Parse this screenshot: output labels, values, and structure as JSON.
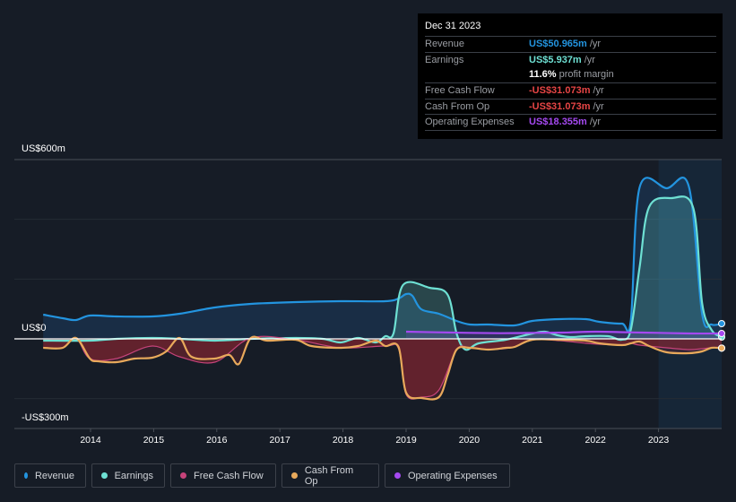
{
  "tooltip": {
    "date": "Dec 31 2023",
    "rows": [
      {
        "label": "Revenue",
        "value": "US$50.965m",
        "unit": "/yr",
        "color": "#2394df"
      },
      {
        "label": "Earnings",
        "value": "US$5.937m",
        "unit": "/yr",
        "color": "#6ee0d3"
      },
      {
        "label": "",
        "value": "11.6%",
        "unit": "profit margin",
        "color": "#ffffff"
      },
      {
        "label": "Free Cash Flow",
        "value": "-US$31.073m",
        "unit": "/yr",
        "color": "#e64545"
      },
      {
        "label": "Cash From Op",
        "value": "-US$31.073m",
        "unit": "/yr",
        "color": "#e64545"
      },
      {
        "label": "Operating Expenses",
        "value": "US$18.355m",
        "unit": "/yr",
        "color": "#a549f0"
      }
    ]
  },
  "legend": [
    {
      "label": "Revenue",
      "color": "#2394df"
    },
    {
      "label": "Earnings",
      "color": "#6ee0d3"
    },
    {
      "label": "Free Cash Flow",
      "color": "#c6437a"
    },
    {
      "label": "Cash From Op",
      "color": "#e8a95b"
    },
    {
      "label": "Operating Expenses",
      "color": "#a549f0"
    }
  ],
  "chart_data": {
    "type": "line",
    "title": "",
    "xlabel": "",
    "ylabel": "",
    "y_tick_labels": [
      "US$600m",
      "US$0",
      "-US$300m"
    ],
    "ylim": [
      -300,
      600
    ],
    "xlim": [
      2013.25,
      2024.0
    ],
    "x_ticks": [
      "2014",
      "2015",
      "2016",
      "2017",
      "2018",
      "2019",
      "2020",
      "2021",
      "2022",
      "2023"
    ],
    "forecast_shade_start": 2023.0,
    "grid": true,
    "legend_position": "bottom-left",
    "series": [
      {
        "name": "Revenue",
        "color": "#2394df",
        "x": [
          2013.25,
          2013.56,
          2013.77,
          2013.99,
          2014.41,
          2014.98,
          2015.41,
          2015.97,
          2016.54,
          2017.25,
          2017.96,
          2018.67,
          2018.88,
          2019.0,
          2019.1,
          2019.24,
          2019.52,
          2019.8,
          2020.01,
          2020.3,
          2020.72,
          2021.0,
          2021.43,
          2021.85,
          2022.06,
          2022.42,
          2022.56,
          2022.7,
          2023.13,
          2023.48,
          2023.69,
          2023.84,
          2024.0
        ],
        "y": [
          81,
          69,
          63,
          78,
          75,
          75,
          84,
          105,
          117,
          123,
          126,
          126,
          135,
          150,
          144,
          99,
          84,
          60,
          48,
          48,
          45,
          60,
          66,
          66,
          57,
          51,
          60,
          507,
          504,
          510,
          84,
          48,
          51
        ]
      },
      {
        "name": "Earnings",
        "color": "#6ee0d3",
        "x": [
          2013.25,
          2013.99,
          2014.41,
          2014.98,
          2015.41,
          2015.97,
          2016.54,
          2017.25,
          2017.68,
          2017.96,
          2018.24,
          2018.52,
          2018.67,
          2018.8,
          2018.95,
          2019.37,
          2019.66,
          2019.8,
          2019.94,
          2020.15,
          2020.58,
          2021.0,
          2021.2,
          2021.4,
          2021.6,
          2021.85,
          2022.2,
          2022.42,
          2022.56,
          2022.7,
          2022.85,
          2023.2,
          2023.55,
          2023.69,
          2023.84,
          2024.0
        ],
        "y": [
          -6,
          -6,
          0,
          3,
          0,
          -6,
          0,
          3,
          0,
          -12,
          3,
          -12,
          9,
          18,
          180,
          171,
          147,
          18,
          -36,
          -15,
          -3,
          18,
          24,
          12,
          6,
          9,
          9,
          -3,
          30,
          240,
          441,
          471,
          438,
          120,
          30,
          6
        ]
      },
      {
        "name": "Free Cash Flow",
        "color": "#c6437a",
        "x": [
          2013.25,
          2013.56,
          2013.77,
          2013.99,
          2014.41,
          2014.98,
          2015.41,
          2015.97,
          2016.54,
          2017.25,
          2017.96,
          2018.67,
          2018.88,
          2019.0,
          2019.25,
          2019.52,
          2019.8,
          2020.01,
          2020.3,
          2020.72,
          2021.0,
          2021.43,
          2021.85,
          2022.06,
          2022.42,
          2022.56,
          2022.7,
          2023.13,
          2023.48,
          2023.69,
          2023.84,
          2024.0
        ],
        "y": [
          -30,
          -30,
          3,
          -66,
          -66,
          -24,
          -60,
          -78,
          3,
          -3,
          -30,
          -24,
          -33,
          -186,
          -195,
          -171,
          -36,
          -30,
          -36,
          -27,
          -3,
          -6,
          -15,
          -18,
          -21,
          -15,
          -21,
          -30,
          -36,
          -33,
          -30,
          -31
        ]
      },
      {
        "name": "Cash From Op",
        "color": "#e8a95b",
        "x": [
          2013.25,
          2013.56,
          2013.77,
          2013.99,
          2014.12,
          2014.41,
          2014.7,
          2014.98,
          2015.2,
          2015.41,
          2015.6,
          2015.97,
          2016.2,
          2016.35,
          2016.54,
          2016.8,
          2017.25,
          2017.5,
          2017.96,
          2018.24,
          2018.52,
          2018.67,
          2018.88,
          2019.0,
          2019.25,
          2019.52,
          2019.66,
          2019.8,
          2020.01,
          2020.3,
          2020.58,
          2020.72,
          2021.0,
          2021.43,
          2021.85,
          2022.06,
          2022.42,
          2022.56,
          2022.7,
          2022.85,
          2023.13,
          2023.48,
          2023.69,
          2023.84,
          2024.0
        ],
        "y": [
          -30,
          -30,
          3,
          -66,
          -75,
          -78,
          -66,
          -63,
          -42,
          3,
          -60,
          -66,
          -54,
          -84,
          3,
          -6,
          -3,
          -24,
          -30,
          -24,
          -6,
          -24,
          -27,
          -180,
          -198,
          -195,
          -120,
          -36,
          -30,
          -36,
          -30,
          -27,
          -3,
          -3,
          -6,
          -15,
          -21,
          -15,
          -9,
          -24,
          -45,
          -48,
          -42,
          -30,
          -31
        ]
      },
      {
        "name": "Operating Expenses",
        "color": "#a549f0",
        "x": [
          2019.0,
          2019.5,
          2020.0,
          2020.5,
          2021.0,
          2021.5,
          2022.0,
          2022.5,
          2023.0,
          2023.5,
          2024.0
        ],
        "y": [
          24,
          22,
          20,
          19,
          20,
          21,
          24,
          22,
          20,
          18,
          18
        ]
      }
    ]
  }
}
